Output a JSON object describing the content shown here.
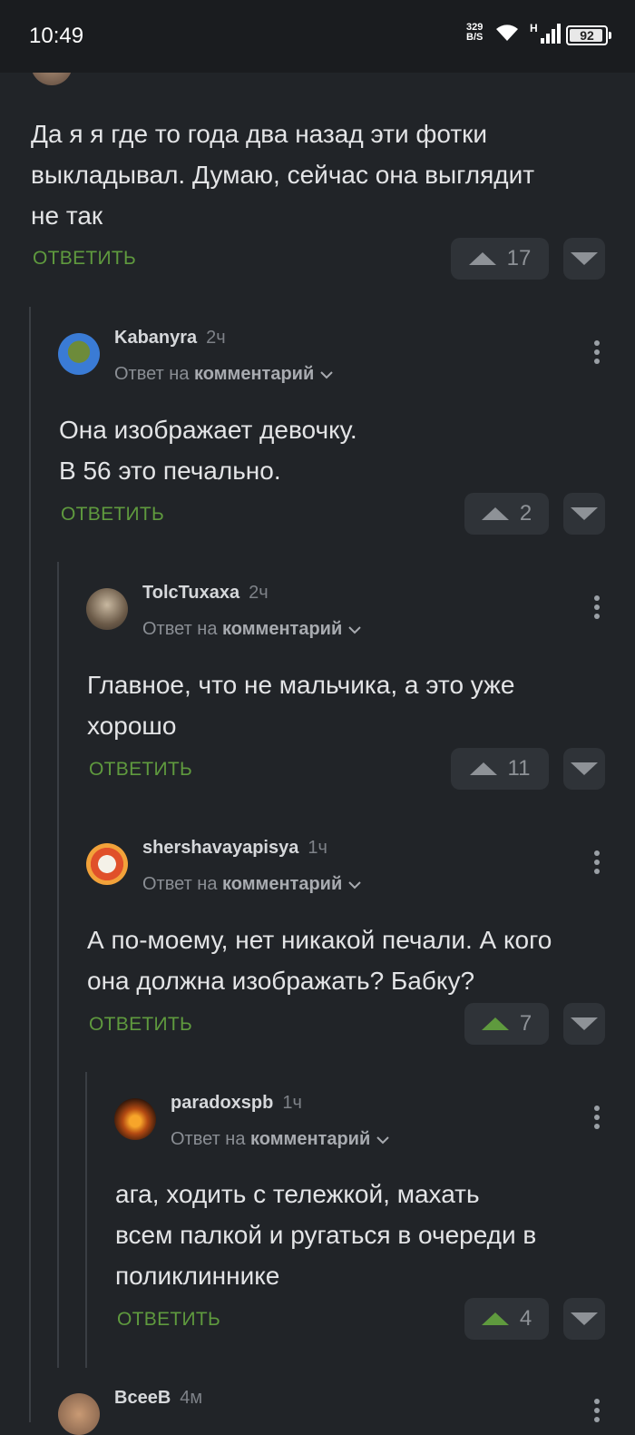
{
  "status_bar": {
    "time": "10:49",
    "net_speed": "329",
    "net_unit": "B/S",
    "network_type": "H",
    "battery": "92"
  },
  "comments": [
    {
      "text_lines": [
        "Да я я где то года два назад эти фотки",
        "выкладывал. Думаю, сейчас она выглядит",
        "не так"
      ],
      "reply_label": "ОТВЕТИТЬ",
      "votes": "17",
      "upvoted": false
    },
    {
      "author": "Kabanyra",
      "age": "2ч",
      "reply_prefix": "Ответ на",
      "reply_target": "комментарий",
      "text_lines": [
        "Она изображает девочку.",
        "В 56 это печально."
      ],
      "reply_label": "ОТВЕТИТЬ",
      "votes": "2",
      "upvoted": false
    },
    {
      "author": "TolcTuxaxa",
      "age": "2ч",
      "reply_prefix": "Ответ на",
      "reply_target": "комментарий",
      "text_lines": [
        "Главное, что не мальчика, а это уже",
        "хорошо"
      ],
      "reply_label": "ОТВЕТИТЬ",
      "votes": "11",
      "upvoted": false
    },
    {
      "author": "shershavayapisya",
      "age": "1ч",
      "reply_prefix": "Ответ на",
      "reply_target": "комментарий",
      "text_lines": [
        "А по-моему, нет никакой печали. А кого",
        "она должна изображать? Бабку?"
      ],
      "reply_label": "ОТВЕТИТЬ",
      "votes": "7",
      "upvoted": true
    },
    {
      "author": "paradoxspb",
      "age": "1ч",
      "reply_prefix": "Ответ на",
      "reply_target": "комментарий",
      "text_lines": [
        "ага, ходить с тележкой, махать",
        "всем палкой и ругаться в очереди в",
        "поликлиннике"
      ],
      "reply_label": "ОТВЕТИТЬ",
      "votes": "4",
      "upvoted": true
    },
    {
      "author": "BceeB",
      "age": "4м"
    }
  ],
  "colors": {
    "background": "#212428",
    "accent_green": "#5f9a3e",
    "vote_bg": "#2f3338"
  }
}
